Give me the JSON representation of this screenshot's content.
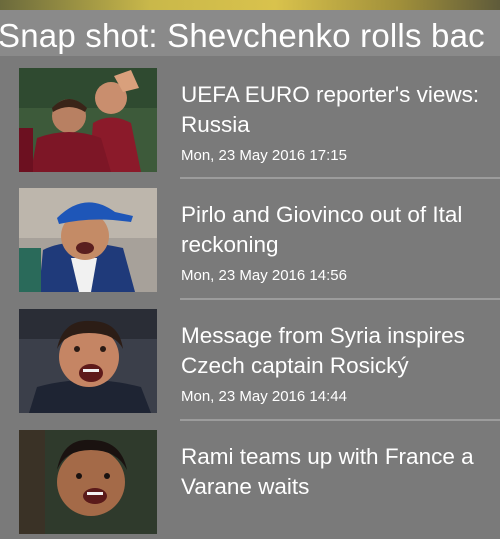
{
  "snapshot": {
    "title": "Snap shot: Shevchenko rolls bac"
  },
  "news": [
    {
      "title_line1": "UEFA EURO reporter's views:",
      "title_line2": "Russia",
      "date": "Mon, 23 May 2016 17:15",
      "thumbnail_icon": "players-celebrating-photo"
    },
    {
      "title_line1": "Pirlo and Giovinco out of Ital",
      "title_line2": "reckoning",
      "date": "Mon, 23 May 2016 14:56",
      "thumbnail_icon": "coach-in-cap-photo"
    },
    {
      "title_line1": "Message from Syria inspires",
      "title_line2": "Czech captain Rosický",
      "date": "Mon, 23 May 2016 14:44",
      "thumbnail_icon": "coach-shouting-photo"
    },
    {
      "title_line1": "Rami teams up with France a",
      "title_line2": "Varane waits",
      "date": "",
      "thumbnail_icon": "player-portrait-photo"
    }
  ],
  "colors": {
    "background": "#7a7a7a",
    "banner": "#8a8a8a",
    "text": "#ffffff",
    "divider": "#9c9c9c"
  }
}
